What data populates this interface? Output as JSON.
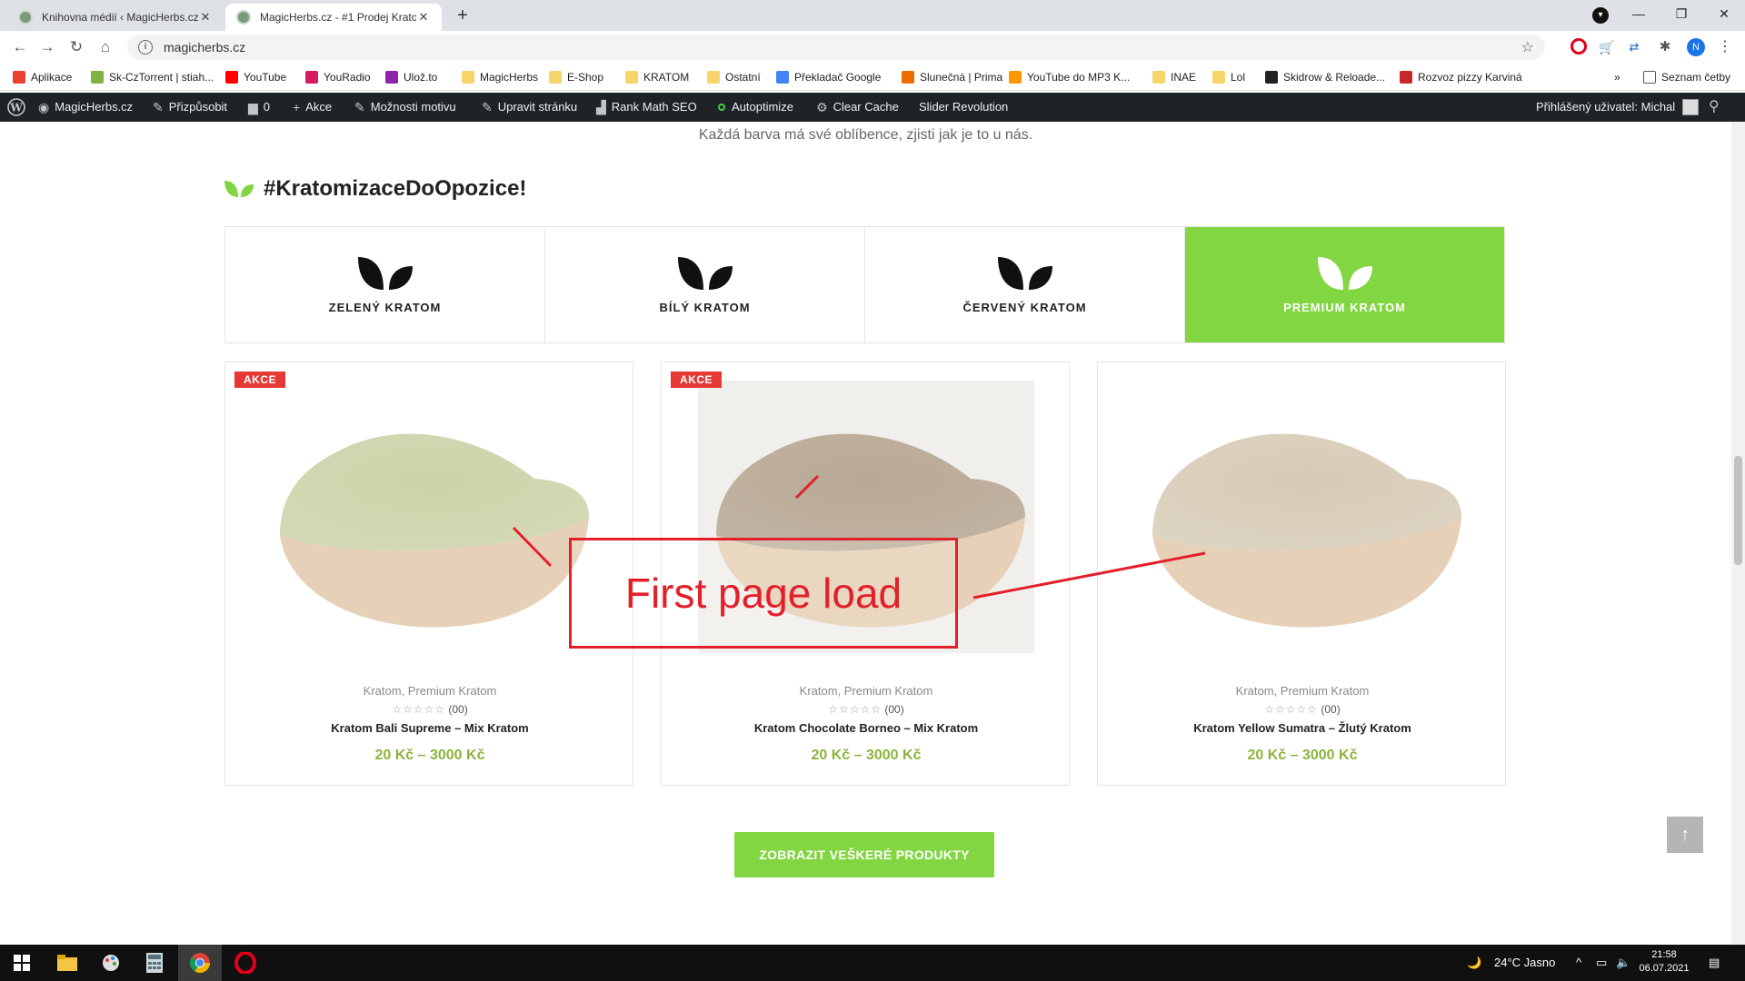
{
  "browser": {
    "tabs": [
      {
        "title": "Knihovna médií ‹ MagicHerbs.cz",
        "active": false
      },
      {
        "title": "MagicHerbs.cz - #1 Prodej Kratom",
        "active": true
      }
    ],
    "url": "magicherbs.cz",
    "profile_initial": "N",
    "bookmarks": [
      {
        "label": "Aplikace",
        "icon": "apps-grid-icon",
        "color": "#e94235"
      },
      {
        "label": "Sk-CzTorrent | stiah...",
        "icon": "torrent-icon",
        "color": "#7cb342"
      },
      {
        "label": "YouTube",
        "icon": "youtube-icon",
        "color": "#ff0000"
      },
      {
        "label": "YouRadio",
        "icon": "music-note-icon",
        "color": "#d81b60"
      },
      {
        "label": "Ulož.to",
        "icon": "ulozto-icon",
        "color": "#8e24aa"
      },
      {
        "label": "MagicHerbs",
        "icon": "folder-icon",
        "color": "#f6d66a"
      },
      {
        "label": "E-Shop",
        "icon": "folder-icon",
        "color": "#f6d66a"
      },
      {
        "label": "KRATOM",
        "icon": "folder-icon",
        "color": "#f6d66a"
      },
      {
        "label": "Ostatní",
        "icon": "folder-icon",
        "color": "#f6d66a"
      },
      {
        "label": "Překladač Google",
        "icon": "google-translate-icon",
        "color": "#4285f4"
      },
      {
        "label": "Slunečná | Prima",
        "icon": "prima-icon",
        "color": "#ef6c00"
      },
      {
        "label": "YouTube do MP3 K...",
        "icon": "converter-icon",
        "color": "#ff9800"
      },
      {
        "label": "INAE",
        "icon": "folder-icon",
        "color": "#f6d66a"
      },
      {
        "label": "Lol",
        "icon": "folder-icon",
        "color": "#f6d66a"
      },
      {
        "label": "Skidrow & Reloade...",
        "icon": "skidrow-icon",
        "color": "#222222"
      },
      {
        "label": "Rozvoz pizzy Karviná",
        "icon": "pizza-icon",
        "color": "#c62828"
      }
    ],
    "reading_list": "Seznam četby"
  },
  "adminbar": {
    "site": "MagicHerbs.cz",
    "customize": "Přizpůsobit",
    "comments": "0",
    "new": "Akce",
    "theme_options": "Možnosti motivu",
    "edit_page": "Upravit stránku",
    "rank_math": "Rank Math SEO",
    "autoptimize": "Autoptimize",
    "clear_cache": "Clear Cache",
    "slider": "Slider Revolution",
    "user": "Přihlášený uživatel: Michal"
  },
  "page": {
    "subtitle": "Každá barva má své oblíbence, zjisti jak je to u nás.",
    "section_title": "#KratomizaceDoOpozice!",
    "categories": [
      {
        "label": "ZELENÝ KRATOM",
        "active": false
      },
      {
        "label": "BÍLÝ KRATOM",
        "active": false
      },
      {
        "label": "ČERVENÝ KRATOM",
        "active": false
      },
      {
        "label": "PREMIUM KRATOM",
        "active": true
      }
    ],
    "products": [
      {
        "badge": "AKCE",
        "category": "Kratom, Premium Kratom",
        "stars": "☆☆☆☆☆",
        "rating_count": "(00)",
        "name": "Kratom Bali Supreme – Mix Kratom",
        "price": "20 Kč – 3000 Kč",
        "powder_color": "#ccd2a8"
      },
      {
        "badge": "AKCE",
        "category": "Kratom, Premium Kratom",
        "stars": "☆☆☆☆☆",
        "rating_count": "(00)",
        "name": "Kratom Chocolate Borneo – Mix Kratom",
        "price": "20 Kč – 3000 Kč",
        "powder_color": "#b8a894"
      },
      {
        "badge": "",
        "category": "Kratom, Premium Kratom",
        "stars": "☆☆☆☆☆",
        "rating_count": "(00)",
        "name": "Kratom Yellow Sumatra – Žlutý Kratom",
        "price": "20 Kč – 3000 Kč",
        "powder_color": "#d6cbb5"
      }
    ],
    "annotation": "First page load",
    "cta": "ZOBRAZIT VEŠKERÉ PRODUKTY",
    "to_top": "↑"
  },
  "taskbar": {
    "weather": "24°C  Jasno",
    "time": "21:58",
    "date": "06.07.2021"
  },
  "colors": {
    "accent_green": "#82d641",
    "price_green": "#8cb33c",
    "badge_red": "#e53935",
    "annotation_red": "#e3202a",
    "admin_bg": "#1d2327"
  }
}
